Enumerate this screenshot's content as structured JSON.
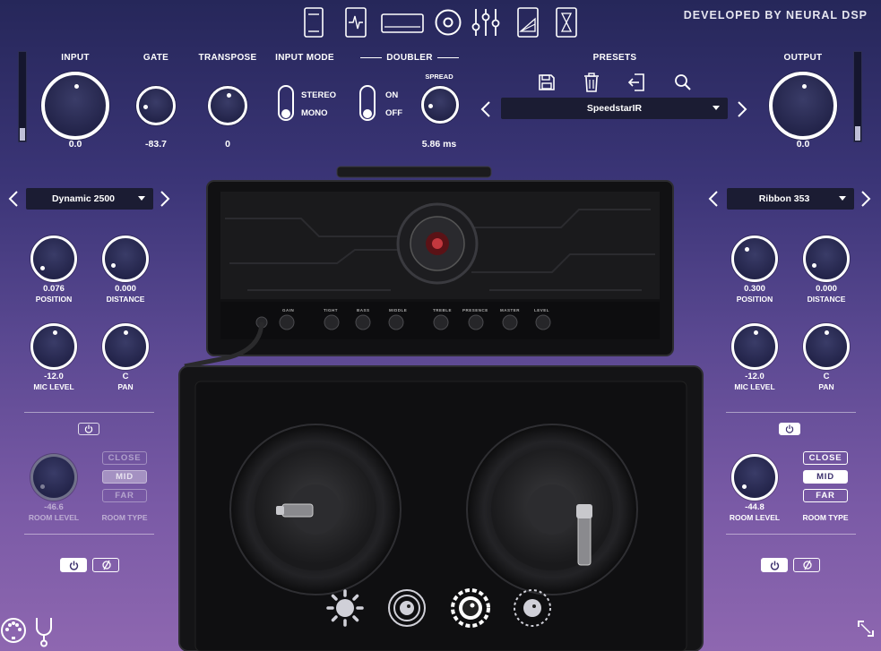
{
  "header": {
    "developer_text": "DEVELOPED BY NEURAL DSP",
    "nav_icons": [
      "tuner-icon",
      "gate-pedal-icon",
      "amp-icon",
      "cabinet-icon",
      "eq-icon",
      "compressor-icon",
      "metronome-icon"
    ]
  },
  "top": {
    "input": {
      "label": "INPUT",
      "value": "0.0"
    },
    "gate": {
      "label": "GATE",
      "value": "-83.7"
    },
    "transpose": {
      "label": "TRANSPOSE",
      "value": "0"
    },
    "input_mode": {
      "label": "INPUT MODE",
      "option_top": "STEREO",
      "option_bottom": "MONO"
    },
    "doubler": {
      "label": "DOUBLER",
      "option_top": "ON",
      "option_bottom": "OFF",
      "spread_label": "SPREAD",
      "spread_value": "5.86 ms"
    },
    "presets": {
      "label": "PRESETS",
      "selected": "SpeedstarIR"
    },
    "output": {
      "label": "OUTPUT",
      "value": "0.0"
    }
  },
  "left_mic": {
    "model": "Dynamic 2500",
    "position": {
      "label": "POSITION",
      "value": "0.076"
    },
    "distance": {
      "label": "DISTANCE",
      "value": "0.000"
    },
    "mic_level": {
      "label": "MIC LEVEL",
      "value": "-12.0"
    },
    "pan": {
      "label": "PAN",
      "value": "C"
    },
    "room_level": {
      "label": "ROOM LEVEL",
      "value": "-46.6"
    },
    "room_type": {
      "label": "ROOM TYPE",
      "options": [
        "CLOSE",
        "MID",
        "FAR"
      ],
      "selected": "MID"
    }
  },
  "right_mic": {
    "model": "Ribbon 353",
    "position": {
      "label": "POSITION",
      "value": "0.300"
    },
    "distance": {
      "label": "DISTANCE",
      "value": "0.000"
    },
    "mic_level": {
      "label": "MIC LEVEL",
      "value": "-12.0"
    },
    "pan": {
      "label": "PAN",
      "value": "C"
    },
    "room_level": {
      "label": "ROOM LEVEL",
      "value": "-44.8"
    },
    "room_type": {
      "label": "ROOM TYPE",
      "options": [
        "CLOSE",
        "MID",
        "FAR"
      ],
      "selected": "MID"
    }
  },
  "amp": {
    "knobs": [
      "GAIN",
      "TIGHT",
      "BASS",
      "MIDDLE",
      "TREBLE",
      "PRESENCE",
      "MASTER",
      "LEVEL"
    ]
  },
  "colors": {
    "background_top": "#26275a",
    "background_bottom": "#8e67b0",
    "panel_dark": "#1b1c33"
  }
}
